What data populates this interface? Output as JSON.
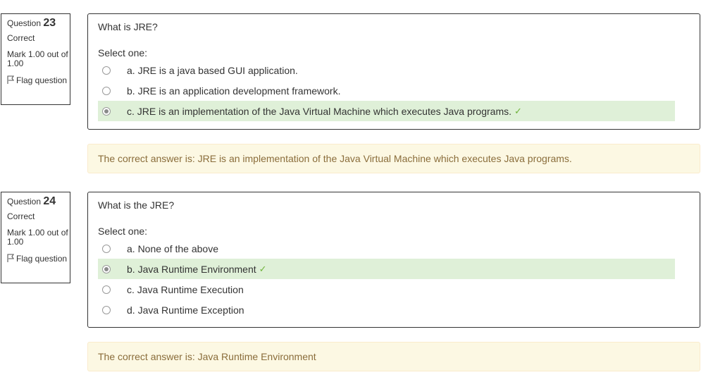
{
  "questions": [
    {
      "label": "Question",
      "number": "23",
      "state": "Correct",
      "mark": "Mark 1.00 out of 1.00",
      "flag": "Flag question",
      "text": "What is JRE?",
      "prompt": "Select one:",
      "answers": [
        "a. JRE is a java based GUI application.",
        "b. JRE is an application development framework.",
        "c. JRE is an implementation of the Java Virtual Machine which executes Java programs."
      ],
      "correct_answer": "The correct answer is: JRE is an implementation of the Java Virtual Machine which executes Java programs."
    },
    {
      "label": "Question",
      "number": "24",
      "state": "Correct",
      "mark": "Mark 1.00 out of 1.00",
      "flag": "Flag question",
      "text": "What is the JRE?",
      "prompt": "Select one:",
      "answers": [
        "a. None of the above",
        "b. Java Runtime Environment",
        "c. Java Runtime Execution",
        "d. Java Runtime Exception"
      ],
      "correct_answer": "The correct answer is: Java Runtime Environment"
    }
  ],
  "colors": {
    "correct_bg": "#dff0d8",
    "check": "#6fb23a",
    "feedback_bg": "#fcf8e3",
    "feedback_text": "#8a6d3b"
  },
  "icons": {
    "flag": "flag-outline-icon",
    "check": "check-icon"
  }
}
